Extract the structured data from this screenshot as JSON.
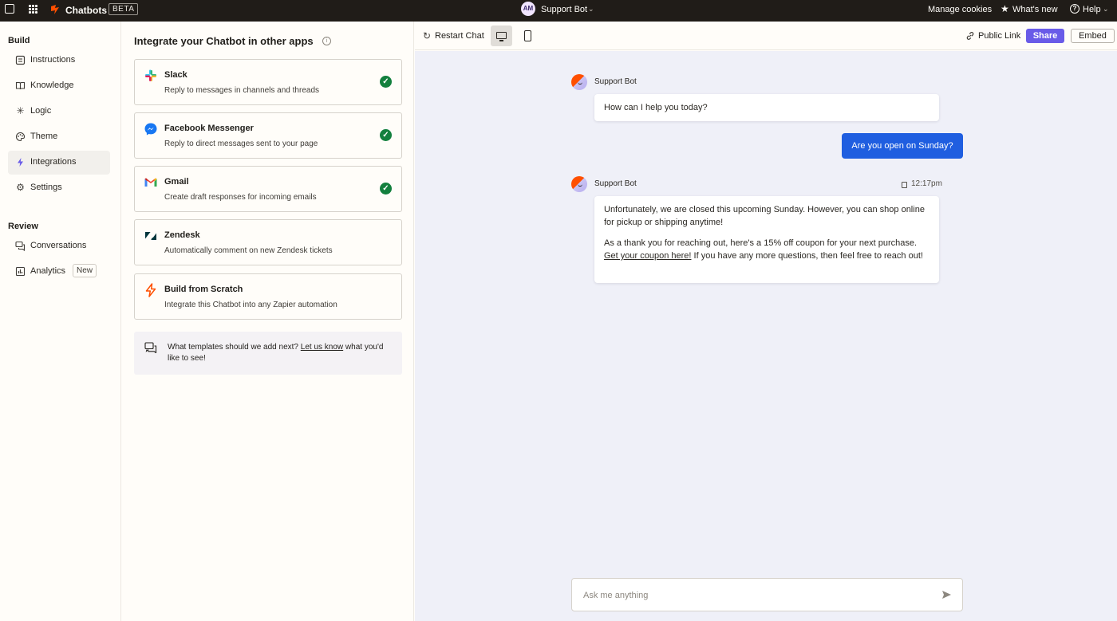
{
  "topbar": {
    "app_name": "Chatbots",
    "beta_label": "BETA",
    "avatar_initials": "AM",
    "bot_name": "Support Bot",
    "manage_cookies": "Manage cookies",
    "whats_new": "What's new",
    "help": "Help"
  },
  "sidebar": {
    "build_title": "Build",
    "build_items": [
      {
        "label": "Instructions",
        "icon": "list-icon"
      },
      {
        "label": "Knowledge",
        "icon": "book-icon"
      },
      {
        "label": "Logic",
        "icon": "sparkle-icon"
      },
      {
        "label": "Theme",
        "icon": "palette-icon"
      },
      {
        "label": "Integrations",
        "icon": "bolt-icon",
        "active": true
      },
      {
        "label": "Settings",
        "icon": "gear-icon"
      }
    ],
    "review_title": "Review",
    "review_items": [
      {
        "label": "Conversations",
        "icon": "chat-icon"
      },
      {
        "label": "Analytics",
        "icon": "chart-icon",
        "badge": "New"
      }
    ]
  },
  "integrations": {
    "title": "Integrate your Chatbot in other apps",
    "cards": [
      {
        "name": "Slack",
        "description": "Reply to messages in channels and threads",
        "connected": true
      },
      {
        "name": "Facebook Messenger",
        "description": "Reply to direct messages sent to your page",
        "connected": true
      },
      {
        "name": "Gmail",
        "description": "Create draft responses for incoming emails",
        "connected": true
      },
      {
        "name": "Zendesk",
        "description": "Automatically comment on new Zendesk tickets",
        "connected": false
      },
      {
        "name": "Build from Scratch",
        "description": "Integrate this Chatbot into any Zapier automation",
        "connected": false
      }
    ],
    "templates_prompt_before": "What templates should we add next?",
    "templates_link": "Let us know",
    "templates_prompt_after": "what you'd like to see!"
  },
  "toolbar": {
    "restart_chat": "Restart Chat",
    "public_link": "Public Link",
    "share": "Share",
    "embed": "Embed"
  },
  "chat": {
    "messages": [
      {
        "from": "bot",
        "sender": "Support Bot",
        "text": "How can I help you today?"
      },
      {
        "from": "user",
        "text": "Are you open on Sunday?"
      },
      {
        "from": "bot",
        "sender": "Support Bot",
        "time": "12:17pm",
        "paragraph1": "Unfortunately, we are closed this upcoming Sunday. However, you can shop online for pickup or shipping anytime!",
        "paragraph2_before": "As a thank you for reaching out, here's a 15% off coupon for your next purchase.",
        "paragraph2_link": "Get your coupon here!",
        "paragraph2_after": "If you have any more questions, then feel free to reach out!"
      }
    ],
    "input_placeholder": "Ask me anything"
  },
  "colors": {
    "topbar_bg": "#201c18",
    "accent": "#695be8",
    "user_bubble": "#1f5ee0",
    "chat_bg": "#eff0f8",
    "check_green": "#13803e",
    "brand_orange": "#ff4f00"
  }
}
